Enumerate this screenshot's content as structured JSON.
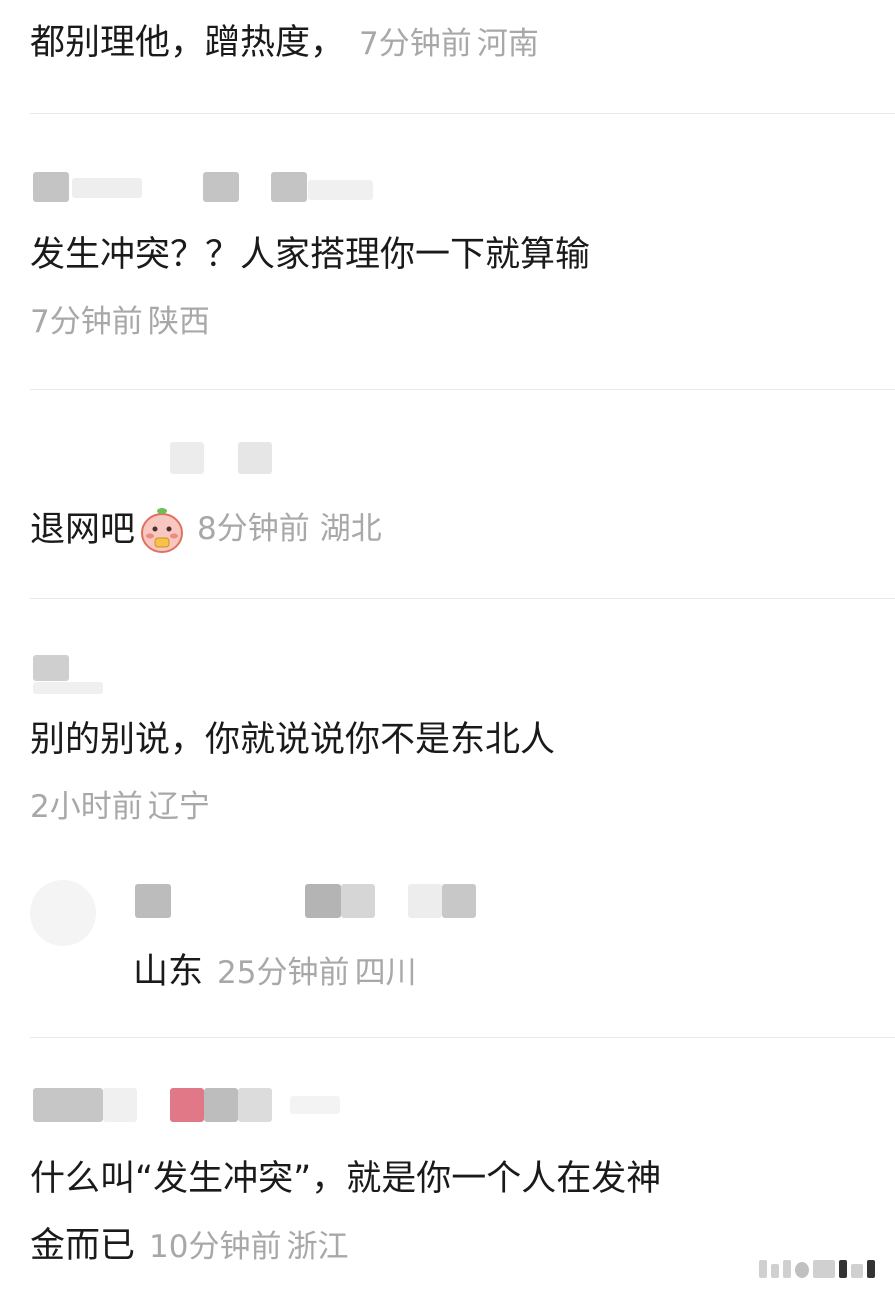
{
  "comments": [
    {
      "text": "都别理他，蹭热度，",
      "time": "7分钟前",
      "region": "河南"
    },
    {
      "text": "发生冲突？？人家搭理你一下就算输",
      "time": "7分钟前",
      "region": "陕西"
    },
    {
      "text": "退网吧",
      "emoji": "cute-character-emoji",
      "time": "8分钟前",
      "region": "湖北"
    },
    {
      "text": "别的别说，你就说说你不是东北人",
      "time": "2小时前",
      "region": "辽宁"
    },
    {
      "text": "什么叫“发生冲突”，就是你一个人在发神",
      "text_line2": "金而已",
      "time": "10分钟前",
      "region": "浙江"
    }
  ],
  "reply": {
    "text": "山东",
    "time": "25分钟前",
    "region": "四川"
  }
}
